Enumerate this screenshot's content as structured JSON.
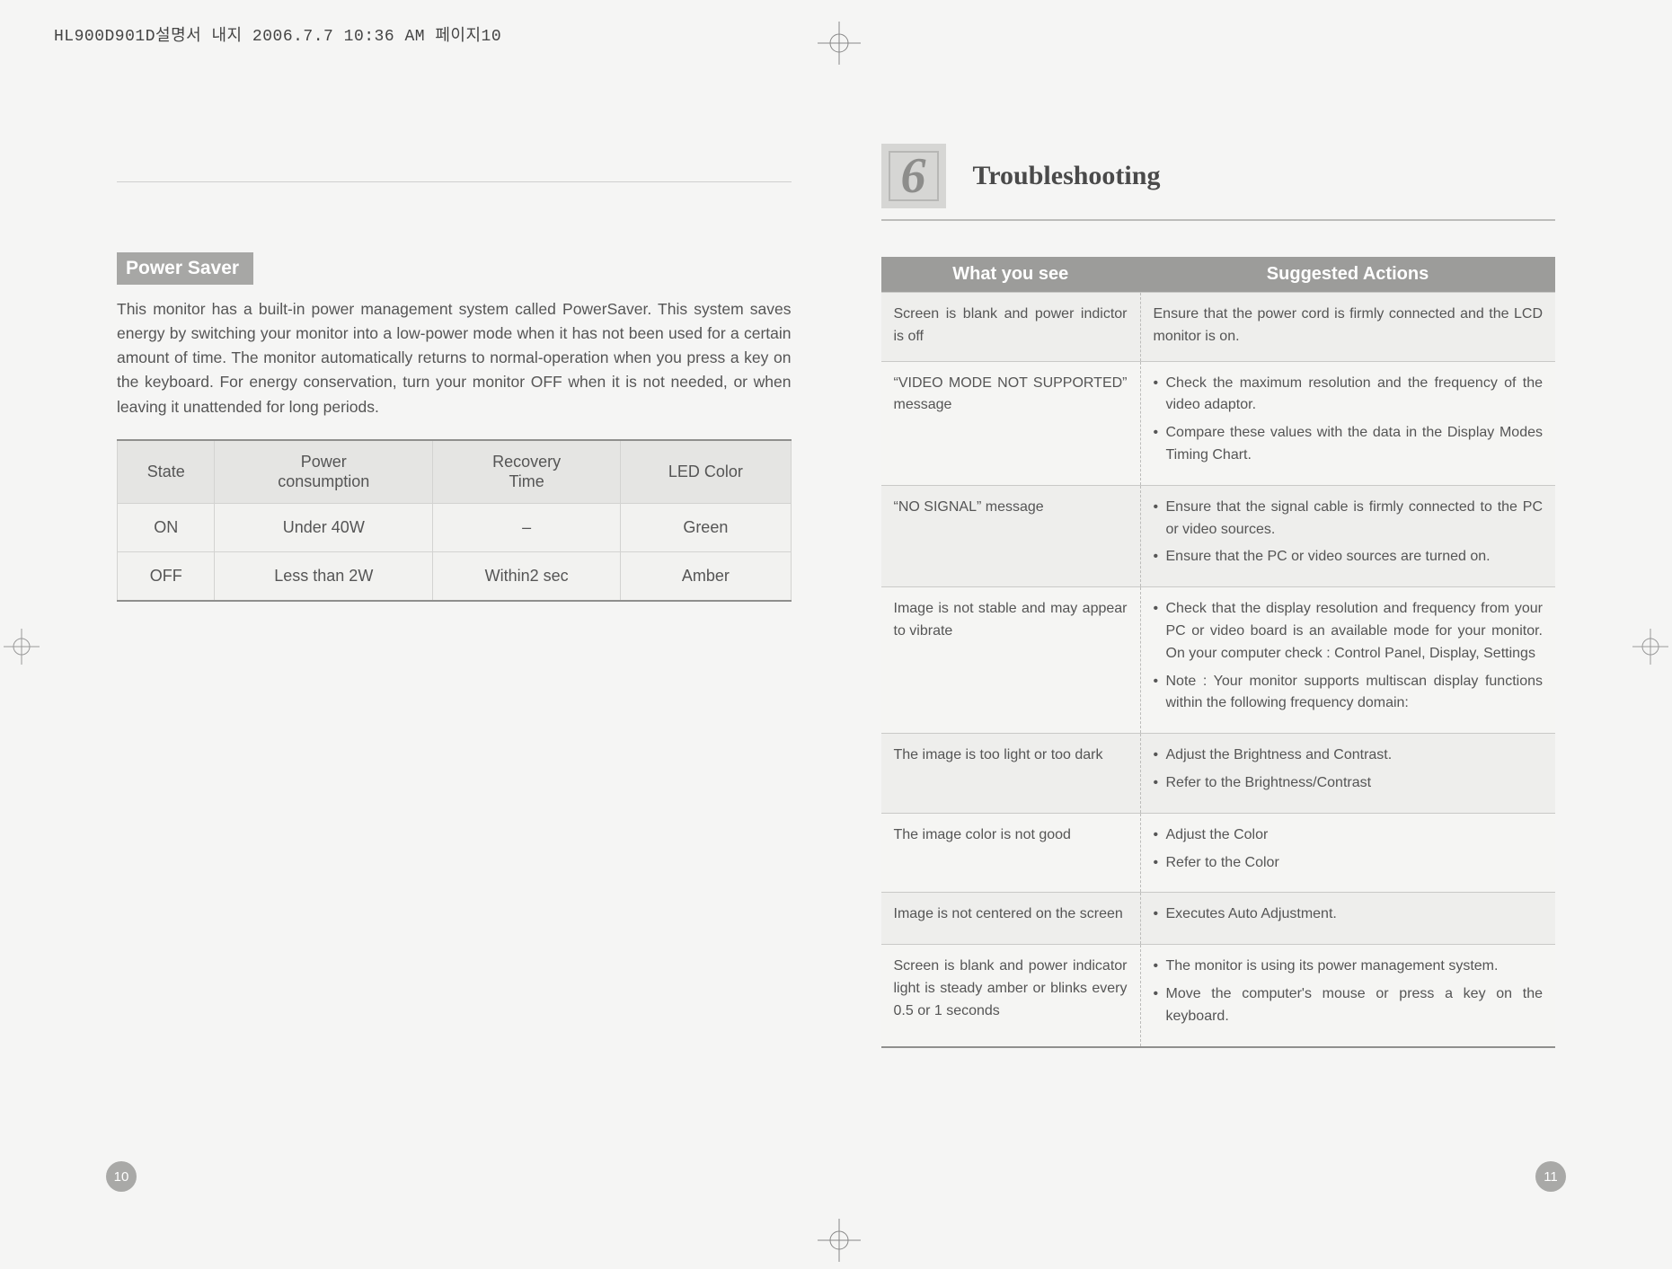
{
  "print_header": "HL900D901D설명서 내지  2006.7.7 10:36 AM  페이지10",
  "chapter": {
    "number": "6",
    "title": "Troubleshooting"
  },
  "left": {
    "sec_head": "Power Saver",
    "body": "This monitor has a built-in power management system called PowerSaver. This system saves energy by switching your monitor into a low-power mode when it has not been used for a certain amount of time. The monitor automatically returns to normal-operation when you press a key on the keyboard. For energy conservation, turn your monitor OFF when it is not needed, or when leaving it unattended for long periods.",
    "table": {
      "headers": [
        "State",
        "Power\nconsumption",
        "Recovery\nTime",
        "LED Color"
      ],
      "rows": [
        [
          "ON",
          "Under 40W",
          "–",
          "Green"
        ],
        [
          "OFF",
          "Less than 2W",
          "Within2 sec",
          "Amber"
        ]
      ]
    },
    "pagenum": "10"
  },
  "right": {
    "table": {
      "headers": [
        "What you see",
        "Suggested Actions"
      ],
      "rows": [
        {
          "sym": "Screen is blank and power indictor is off",
          "act": {
            "type": "text",
            "text": "Ensure that the power cord is firmly connected and the LCD monitor is on."
          }
        },
        {
          "sym": "“VIDEO MODE NOT SUPPORTED” message",
          "act": {
            "type": "list",
            "items": [
              "Check the maximum resolution and the frequency of the video adaptor.",
              "Compare these values with the data in the Display Modes Timing Chart."
            ]
          }
        },
        {
          "sym": "“NO SIGNAL” message",
          "act": {
            "type": "list",
            "items": [
              "Ensure that the signal cable is firmly connected to the PC or video sources.",
              "Ensure that the PC or video sources are turned on."
            ]
          }
        },
        {
          "sym": "Image is not stable and may appear to vibrate",
          "act": {
            "type": "list_note",
            "items": [
              "Check that the display resolution and frequency from your PC or video board is an available mode for your monitor. On your computer check : Control Panel, Display, Settings"
            ],
            "note": "Note : Your monitor supports multiscan display functions within the following frequency domain:"
          }
        },
        {
          "sym": "The image is too light or too dark",
          "act": {
            "type": "list",
            "items": [
              "Adjust the Brightness and Contrast.",
              "Refer  to the Brightness/Contrast"
            ]
          }
        },
        {
          "sym": "The image color is not good",
          "act": {
            "type": "list",
            "items": [
              "Adjust the Color",
              "Refer to the Color"
            ]
          }
        },
        {
          "sym": "Image is not centered on the screen",
          "act": {
            "type": "list",
            "items": [
              "Executes Auto Adjustment."
            ]
          }
        },
        {
          "sym": "Screen is blank and power indicator light is steady amber or blinks every 0.5 or 1 seconds",
          "act": {
            "type": "list",
            "items": [
              "The monitor is using its power management system.",
              "Move the computer's mouse or press a key on the keyboard."
            ]
          }
        }
      ]
    },
    "pagenum": "11"
  }
}
